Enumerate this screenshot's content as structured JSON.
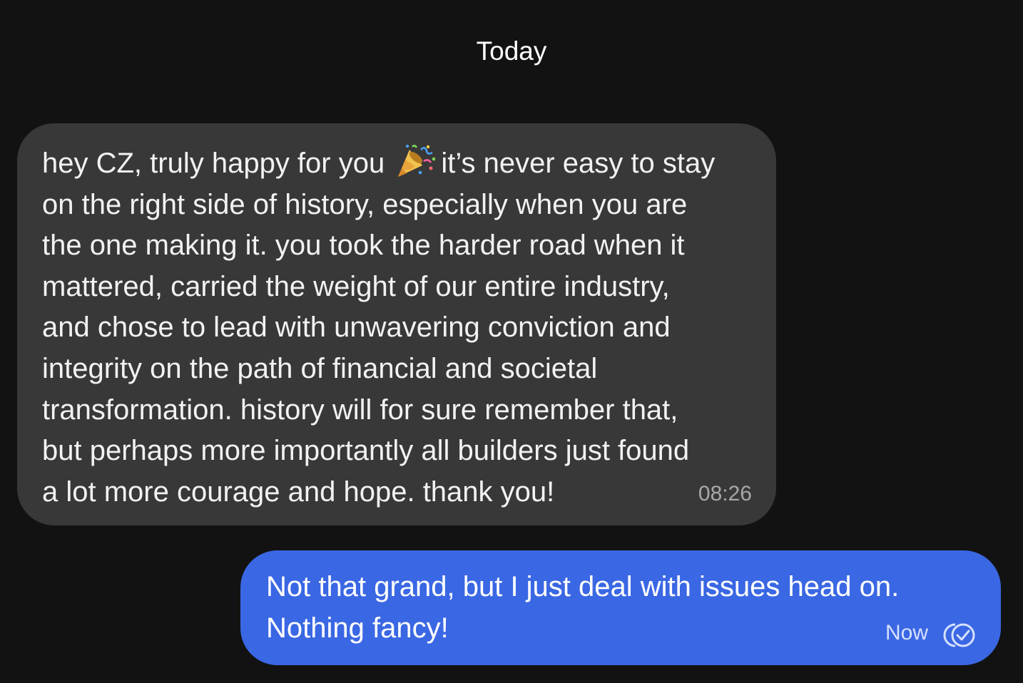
{
  "conversation": {
    "date_divider": "Today"
  },
  "incoming_message": {
    "lines": [
      {
        "before_emoji": "hey CZ, truly happy for you",
        "after_emoji": "it’s never easy to stay"
      },
      "on the right side of history, especially when you are",
      "the one making it. you took the harder road when it",
      "mattered, carried the weight of our entire industry,",
      "and chose to lead with unwavering conviction and",
      "integrity on the path of financial and societal",
      "transformation. history will for sure remember that,",
      "but perhaps more importantly all builders just found",
      "a lot more courage and hope. thank you!"
    ],
    "emoji": "party-popper-icon",
    "time": "08:26",
    "bubble_color": "#383838"
  },
  "outgoing_message": {
    "lines": [
      "Not that grand, but I just deal with issues head on.",
      "Nothing fancy!"
    ],
    "time": "Now",
    "status_icon": "read-checkmark-icon",
    "bubble_color": "#3a67e3"
  },
  "colors": {
    "background": "#121212",
    "accent": "#3a67e3"
  }
}
